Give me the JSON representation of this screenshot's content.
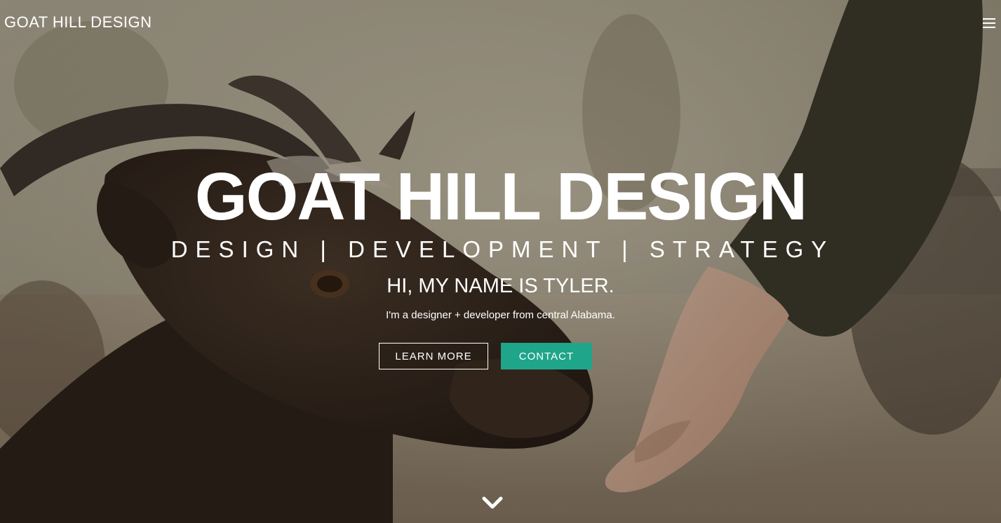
{
  "nav": {
    "brand": "GOAT HILL DESIGN",
    "menu_icon": "hamburger-menu-icon"
  },
  "hero": {
    "title": "GOAT HILL DESIGN",
    "subtitle": "DESIGN | DEVELOPMENT | STRATEGY",
    "greeting": "HI, MY NAME IS TYLER.",
    "intro": "I'm a designer + developer from central Alabama.",
    "learn_more_label": "LEARN MORE",
    "contact_label": "CONTACT",
    "scroll_icon": "chevron-down-icon",
    "background_image": "goat-and-hand-photo"
  },
  "colors": {
    "accent": "#1fa58a",
    "text": "#ffffff"
  }
}
